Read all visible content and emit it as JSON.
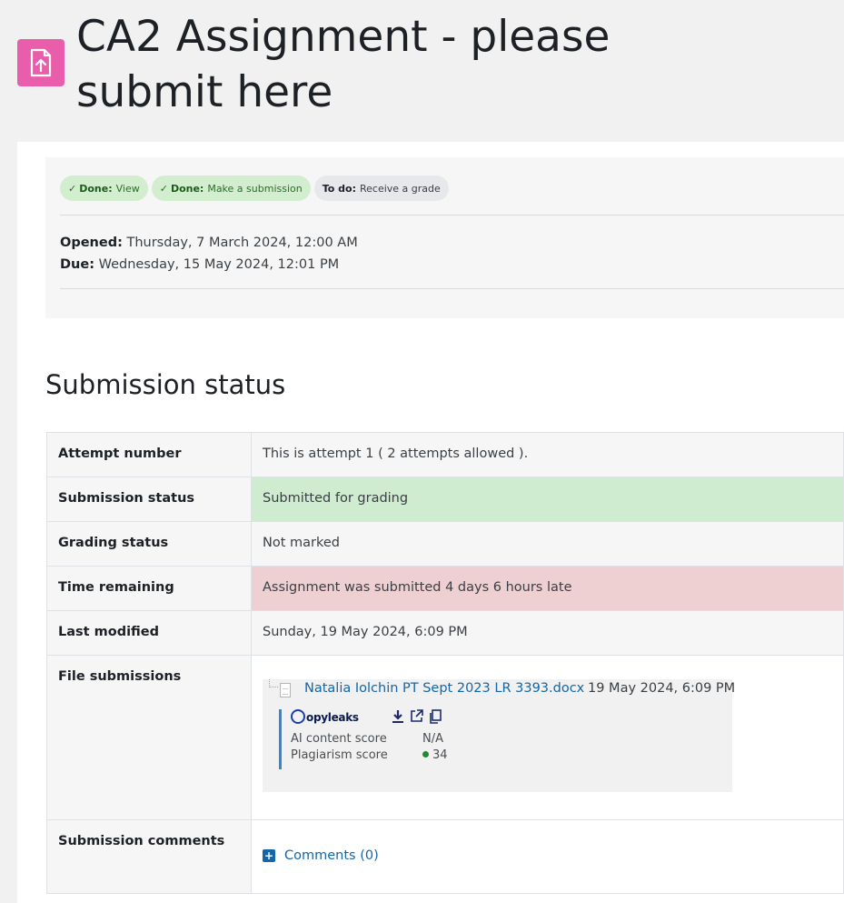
{
  "page": {
    "title": "CA2 Assignment - please submit here",
    "icon": "assignment-upload-icon",
    "accent_color": "#e95eaa"
  },
  "completion": {
    "badges": [
      {
        "state": "Done:",
        "label": "View",
        "status": "done"
      },
      {
        "state": "Done:",
        "label": "Make a submission",
        "status": "done"
      },
      {
        "state": "To do:",
        "label": "Receive a grade",
        "status": "todo"
      }
    ]
  },
  "dates": {
    "opened_label": "Opened:",
    "opened_value": "Thursday, 7 March 2024, 12:00 AM",
    "due_label": "Due:",
    "due_value": "Wednesday, 15 May 2024, 12:01 PM"
  },
  "submission": {
    "heading": "Submission status",
    "rows": [
      {
        "label": "Attempt number",
        "value": "This is attempt 1 ( 2 attempts allowed )."
      },
      {
        "label": "Submission status",
        "value": "Submitted for grading",
        "color": "#cfebd0"
      },
      {
        "label": "Grading status",
        "value": "Not marked"
      },
      {
        "label": "Time remaining",
        "value": "Assignment was submitted 4 days 6 hours late",
        "color": "#efd0d2"
      },
      {
        "label": "Last modified",
        "value": "Sunday, 19 May 2024, 6:09 PM"
      },
      {
        "label": "File submissions"
      },
      {
        "label": "Submission comments"
      }
    ],
    "file": {
      "name": "Natalia Iolchin PT Sept 2023 LR 3393.docx",
      "date": "19 May 2024, 6:09 PM"
    },
    "copyleaks": {
      "logo_text": "opyleaks",
      "ai_label": "AI content score",
      "ai_value": "N/A",
      "plag_label": "Plagiarism score",
      "plag_value": "34"
    },
    "comments_link": "Comments (0)"
  }
}
